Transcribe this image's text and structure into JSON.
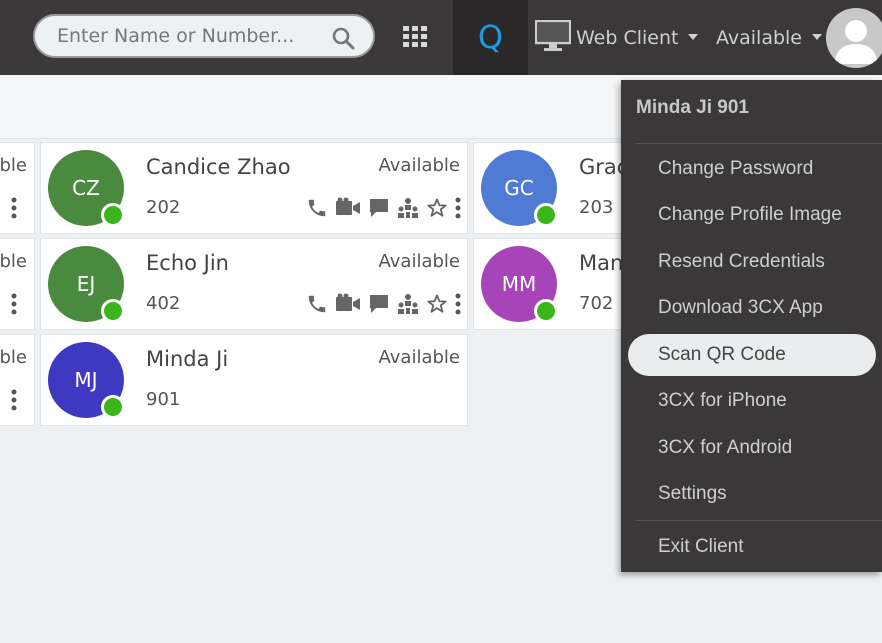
{
  "topbar": {
    "search_placeholder": "Enter Name or Number...",
    "q_label": "Q",
    "client_label": "Web Client",
    "status_label": "Available",
    "accent_color": "#1e9be0"
  },
  "contacts": [
    {
      "initials": "CZ",
      "name": "Candice Zhao",
      "ext": "202",
      "status": "Available",
      "color": "#4a8a3e"
    },
    {
      "initials": "GC",
      "name": "Grac",
      "ext": "203",
      "color": "#4f7bd4"
    },
    {
      "initials": "EJ",
      "name": "Echo Jin",
      "ext": "402",
      "status": "Available",
      "color": "#4a8a3e"
    },
    {
      "initials": "MM",
      "name": "Man",
      "ext": "702",
      "color": "#a644b8"
    },
    {
      "initials": "MJ",
      "name": "Minda Ji",
      "ext": "901",
      "status": "Available",
      "color": "#3e39c0"
    }
  ],
  "left_partial": {
    "status_fragment": "ble"
  },
  "user_menu": {
    "header": "Minda Ji 901",
    "items": [
      "Change Password",
      "Change Profile Image",
      "Resend Credentials",
      "Download 3CX App",
      "Scan QR Code",
      "3CX for iPhone",
      "3CX for Android",
      "Settings",
      "Exit Client"
    ],
    "active_item": "Scan QR Code"
  },
  "icons": [
    "search-icon",
    "dialpad-icon",
    "monitor-icon",
    "caret-down-icon",
    "user-avatar-icon",
    "phone-icon",
    "video-icon",
    "chat-icon",
    "conference-icon",
    "star-icon",
    "more-vertical-icon"
  ]
}
